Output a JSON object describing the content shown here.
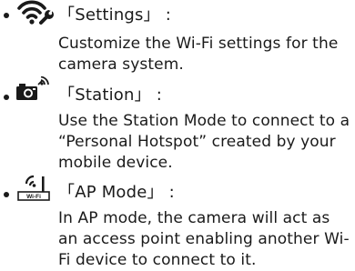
{
  "items": [
    {
      "icon": "wifi-settings-icon",
      "title": "「Settings」 :",
      "description": "Customize the Wi-Fi settings for the camera system."
    },
    {
      "icon": "camera-station-icon",
      "title": "「Station」 :",
      "description": "Use the Station Mode to connect to a “Personal Hotspot” created by your mobile device."
    },
    {
      "icon": "wifi-ap-router-icon",
      "title": "「AP Mode」 :",
      "description": "In AP mode, the camera will act as an access point enabling another Wi-Fi device to connect to it.",
      "icon_badge_text": "Wi-Fi"
    }
  ]
}
